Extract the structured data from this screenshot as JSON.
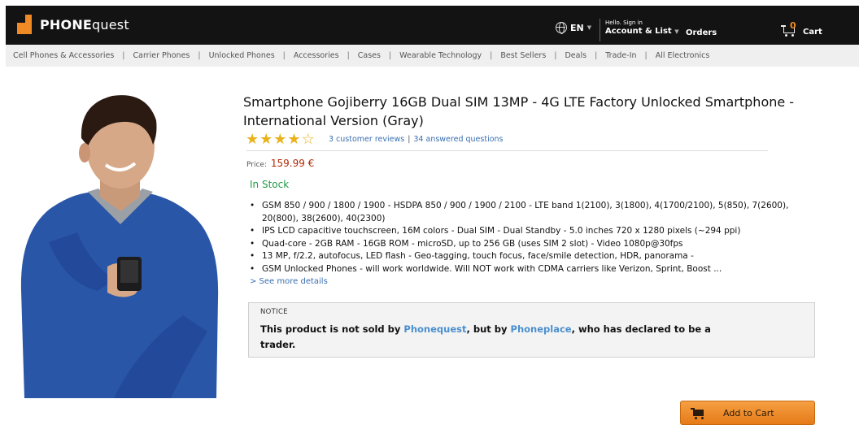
{
  "header": {
    "brand_bold": "PHONE",
    "brand_rest": "quest",
    "language": "EN",
    "greeting": "Hello. Sign in",
    "account_label": "Account & List",
    "orders_label": "Orders",
    "cart_count": "0",
    "cart_label": "Cart"
  },
  "category_nav": [
    "Cell Phones & Accessories",
    "Carrier Phones",
    "Unlocked Phones",
    "Accessories",
    "Cases",
    "Wearable Technology",
    "Best Sellers",
    "Deals",
    "Trade-In",
    "All Electronics"
  ],
  "product": {
    "title": "Smartphone Gojiberry 16GB Dual SIM 13MP - 4G LTE Factory Unlocked Smartphone - International Version (Gray)",
    "rating": 4,
    "rating_max": 5,
    "reviews_link": "3 customer reviews",
    "questions_link": "34 answered questions",
    "price_label": "Price:",
    "price": "159.99 €",
    "stock": "In Stock",
    "features": [
      "GSM 850 / 900 / 1800 / 1900 - HSDPA 850 / 900 / 1900 / 2100 - LTE band 1(2100), 3(1800), 4(1700/2100), 5(850), 7(2600), 20(800), 38(2600), 40(2300)",
      "IPS LCD capacitive touchscreen, 16M colors - Dual SIM - Dual Standby - 5.0 inches 720 x 1280 pixels (~294 ppi)",
      "Quad-core - 2GB RAM - 16GB ROM - microSD, up to 256 GB (uses SIM 2 slot) - Video 1080p@30fps",
      "13 MP, f/2.2, autofocus, LED flash - Geo-tagging, touch focus, face/smile detection, HDR, panorama -",
      "GSM Unlocked Phones - will work worldwide. Will NOT work with CDMA carriers like Verizon, Sprint, Boost ..."
    ],
    "more_details": "> See more details"
  },
  "notice": {
    "label": "NOTICE",
    "text_1": "This product is not sold by ",
    "seller_platform": "Phonequest",
    "text_2": ", but by ",
    "seller": "Phoneplace",
    "text_3": ", who has declared to be a trader."
  },
  "actions": {
    "add_to_cart": "Add to Cart"
  },
  "colors": {
    "header_bg": "#131313",
    "accent_orange": "#f08a24",
    "price_red": "#b12704",
    "stock_green": "#1f9a45",
    "link_blue": "#3a6fb0",
    "sweater_blue": "#2a56a8"
  }
}
